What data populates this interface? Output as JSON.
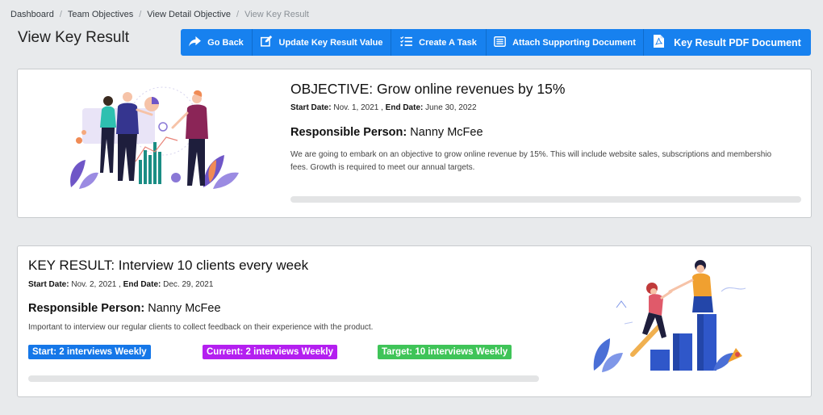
{
  "breadcrumb": {
    "items": [
      "Dashboard",
      "Team Objectives",
      "View Detail Objective"
    ],
    "current": "View Key Result",
    "separator": "/"
  },
  "page_title": "View Key Result",
  "toolbar": {
    "go_back": "Go Back",
    "update": "Update Key Result Value",
    "create_task": "Create A Task",
    "attach": "Attach Supporting Document",
    "pdf": "Key Result PDF Document"
  },
  "objective": {
    "title": "OBJECTIVE: Grow online revenues by 15%",
    "start_label": "Start Date:",
    "start_value": "Nov. 1, 2021",
    "end_label": "End Date:",
    "end_value": "June 30, 2022",
    "responsible_label": "Responsible Person:",
    "responsible_value": "Nanny McFee",
    "description": "We are going to embark on an objective to grow online revenue by 15%. This will include website sales, subscriptions and membershio fees. Growth is required to meet our annual targets.",
    "progress": 0
  },
  "key_result": {
    "title": "KEY RESULT: Interview 10 clients every week",
    "start_label": "Start Date:",
    "start_value": "Nov. 2, 2021",
    "end_label": "End Date:",
    "end_value": "Dec. 29, 2021",
    "responsible_label": "Responsible Person:",
    "responsible_value": "Nanny McFee",
    "description": "Important to interview our regular clients to collect feedback on their experience with the product.",
    "badge_start": "Start: 2 interviews Weekly",
    "badge_current": "Current: 2 interviews Weekly",
    "badge_target": "Target: 10 interviews Weekly",
    "progress": 0
  },
  "colors": {
    "primary": "#1781ef",
    "badge_start": "#1577e8",
    "badge_current": "#b41ff0",
    "badge_target": "#3fc458",
    "progress_track": "#e3e4e5"
  },
  "icons": [
    "share-arrow-icon",
    "edit-icon",
    "task-list-icon",
    "document-list-icon",
    "pdf-file-icon"
  ]
}
